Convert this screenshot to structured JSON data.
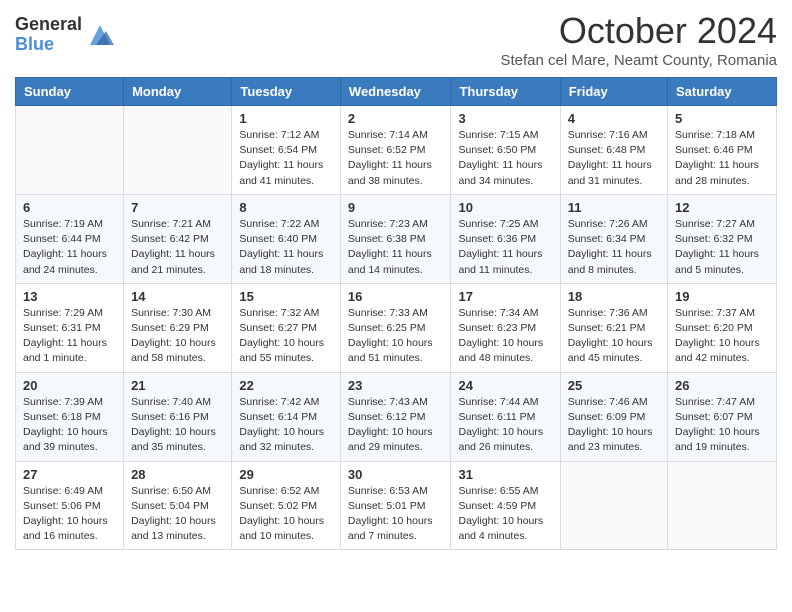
{
  "logo": {
    "general": "General",
    "blue": "Blue"
  },
  "header": {
    "month": "October 2024",
    "subtitle": "Stefan cel Mare, Neamt County, Romania"
  },
  "days_of_week": [
    "Sunday",
    "Monday",
    "Tuesday",
    "Wednesday",
    "Thursday",
    "Friday",
    "Saturday"
  ],
  "weeks": [
    [
      {
        "day": "",
        "info": ""
      },
      {
        "day": "",
        "info": ""
      },
      {
        "day": "1",
        "info": "Sunrise: 7:12 AM\nSunset: 6:54 PM\nDaylight: 11 hours and 41 minutes."
      },
      {
        "day": "2",
        "info": "Sunrise: 7:14 AM\nSunset: 6:52 PM\nDaylight: 11 hours and 38 minutes."
      },
      {
        "day": "3",
        "info": "Sunrise: 7:15 AM\nSunset: 6:50 PM\nDaylight: 11 hours and 34 minutes."
      },
      {
        "day": "4",
        "info": "Sunrise: 7:16 AM\nSunset: 6:48 PM\nDaylight: 11 hours and 31 minutes."
      },
      {
        "day": "5",
        "info": "Sunrise: 7:18 AM\nSunset: 6:46 PM\nDaylight: 11 hours and 28 minutes."
      }
    ],
    [
      {
        "day": "6",
        "info": "Sunrise: 7:19 AM\nSunset: 6:44 PM\nDaylight: 11 hours and 24 minutes."
      },
      {
        "day": "7",
        "info": "Sunrise: 7:21 AM\nSunset: 6:42 PM\nDaylight: 11 hours and 21 minutes."
      },
      {
        "day": "8",
        "info": "Sunrise: 7:22 AM\nSunset: 6:40 PM\nDaylight: 11 hours and 18 minutes."
      },
      {
        "day": "9",
        "info": "Sunrise: 7:23 AM\nSunset: 6:38 PM\nDaylight: 11 hours and 14 minutes."
      },
      {
        "day": "10",
        "info": "Sunrise: 7:25 AM\nSunset: 6:36 PM\nDaylight: 11 hours and 11 minutes."
      },
      {
        "day": "11",
        "info": "Sunrise: 7:26 AM\nSunset: 6:34 PM\nDaylight: 11 hours and 8 minutes."
      },
      {
        "day": "12",
        "info": "Sunrise: 7:27 AM\nSunset: 6:32 PM\nDaylight: 11 hours and 5 minutes."
      }
    ],
    [
      {
        "day": "13",
        "info": "Sunrise: 7:29 AM\nSunset: 6:31 PM\nDaylight: 11 hours and 1 minute."
      },
      {
        "day": "14",
        "info": "Sunrise: 7:30 AM\nSunset: 6:29 PM\nDaylight: 10 hours and 58 minutes."
      },
      {
        "day": "15",
        "info": "Sunrise: 7:32 AM\nSunset: 6:27 PM\nDaylight: 10 hours and 55 minutes."
      },
      {
        "day": "16",
        "info": "Sunrise: 7:33 AM\nSunset: 6:25 PM\nDaylight: 10 hours and 51 minutes."
      },
      {
        "day": "17",
        "info": "Sunrise: 7:34 AM\nSunset: 6:23 PM\nDaylight: 10 hours and 48 minutes."
      },
      {
        "day": "18",
        "info": "Sunrise: 7:36 AM\nSunset: 6:21 PM\nDaylight: 10 hours and 45 minutes."
      },
      {
        "day": "19",
        "info": "Sunrise: 7:37 AM\nSunset: 6:20 PM\nDaylight: 10 hours and 42 minutes."
      }
    ],
    [
      {
        "day": "20",
        "info": "Sunrise: 7:39 AM\nSunset: 6:18 PM\nDaylight: 10 hours and 39 minutes."
      },
      {
        "day": "21",
        "info": "Sunrise: 7:40 AM\nSunset: 6:16 PM\nDaylight: 10 hours and 35 minutes."
      },
      {
        "day": "22",
        "info": "Sunrise: 7:42 AM\nSunset: 6:14 PM\nDaylight: 10 hours and 32 minutes."
      },
      {
        "day": "23",
        "info": "Sunrise: 7:43 AM\nSunset: 6:12 PM\nDaylight: 10 hours and 29 minutes."
      },
      {
        "day": "24",
        "info": "Sunrise: 7:44 AM\nSunset: 6:11 PM\nDaylight: 10 hours and 26 minutes."
      },
      {
        "day": "25",
        "info": "Sunrise: 7:46 AM\nSunset: 6:09 PM\nDaylight: 10 hours and 23 minutes."
      },
      {
        "day": "26",
        "info": "Sunrise: 7:47 AM\nSunset: 6:07 PM\nDaylight: 10 hours and 19 minutes."
      }
    ],
    [
      {
        "day": "27",
        "info": "Sunrise: 6:49 AM\nSunset: 5:06 PM\nDaylight: 10 hours and 16 minutes."
      },
      {
        "day": "28",
        "info": "Sunrise: 6:50 AM\nSunset: 5:04 PM\nDaylight: 10 hours and 13 minutes."
      },
      {
        "day": "29",
        "info": "Sunrise: 6:52 AM\nSunset: 5:02 PM\nDaylight: 10 hours and 10 minutes."
      },
      {
        "day": "30",
        "info": "Sunrise: 6:53 AM\nSunset: 5:01 PM\nDaylight: 10 hours and 7 minutes."
      },
      {
        "day": "31",
        "info": "Sunrise: 6:55 AM\nSunset: 4:59 PM\nDaylight: 10 hours and 4 minutes."
      },
      {
        "day": "",
        "info": ""
      },
      {
        "day": "",
        "info": ""
      }
    ]
  ]
}
